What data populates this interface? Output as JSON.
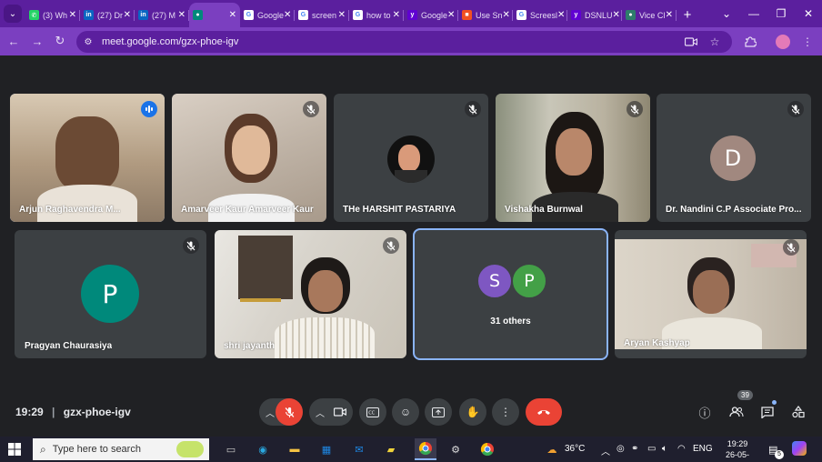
{
  "browser": {
    "tabs": [
      {
        "label": "(3) Wh",
        "fav_color": "#25d366",
        "fav": "✆"
      },
      {
        "label": "(27) Dr",
        "fav_color": "#0a66c2",
        "fav": "in"
      },
      {
        "label": "(27) M",
        "fav_color": "#0a66c2",
        "fav": "in"
      },
      {
        "label": "",
        "fav_color": "#00897b",
        "fav": "●",
        "active": true
      },
      {
        "label": "Google",
        "fav_color": "#ffffff",
        "fav": "G"
      },
      {
        "label": "screen",
        "fav_color": "#ffffff",
        "fav": "G"
      },
      {
        "label": "how to",
        "fav_color": "#ffffff",
        "fav": "G"
      },
      {
        "label": "Google",
        "fav_color": "#6001d2",
        "fav": "y"
      },
      {
        "label": "Use Sn",
        "fav_color": "#f25022",
        "fav": "■"
      },
      {
        "label": "Screesl",
        "fav_color": "#ffffff",
        "fav": "G"
      },
      {
        "label": "DSNLU",
        "fav_color": "#6001d2",
        "fav": "y"
      },
      {
        "label": "Vice Cl",
        "fav_color": "#2e7d6b",
        "fav": "●"
      }
    ],
    "url": "meet.google.com/gzx-phoe-igv"
  },
  "participants_row1": [
    {
      "name": "Arjun Raghavendra M...",
      "kind": "camera",
      "speaking": true
    },
    {
      "name": "Amarveer Kaur Amarveer Kaur",
      "kind": "camera"
    },
    {
      "name": "THe HARSHIT PASTARIYA",
      "kind": "photo"
    },
    {
      "name": "Vishakha Burnwal",
      "kind": "camera"
    },
    {
      "name": "Dr. Nandini C.P Associate Pro...",
      "kind": "avatar",
      "initial": "D",
      "color": "#a1887f"
    }
  ],
  "participants_row2": [
    {
      "name": "Pragyan Chaurasiya",
      "kind": "avatar",
      "initial": "P",
      "color": "#00897b"
    },
    {
      "name": "shri jayanth",
      "kind": "camera"
    },
    {
      "name": "Aryan Kashyap",
      "kind": "camera"
    }
  ],
  "others": {
    "label": "31 others",
    "avatars": [
      {
        "initial": "S",
        "color": "#7e57c2"
      },
      {
        "initial": "P",
        "color": "#43a047"
      }
    ]
  },
  "meeting": {
    "time": "19:29",
    "code": "gzx-phoe-igv",
    "participant_count": "39"
  },
  "taskbar": {
    "search_placeholder": "Type here to search",
    "temperature": "36°C",
    "lang": "ENG",
    "clock_time": "19:29",
    "clock_date": "26-05-2024",
    "notif_count": "5"
  }
}
